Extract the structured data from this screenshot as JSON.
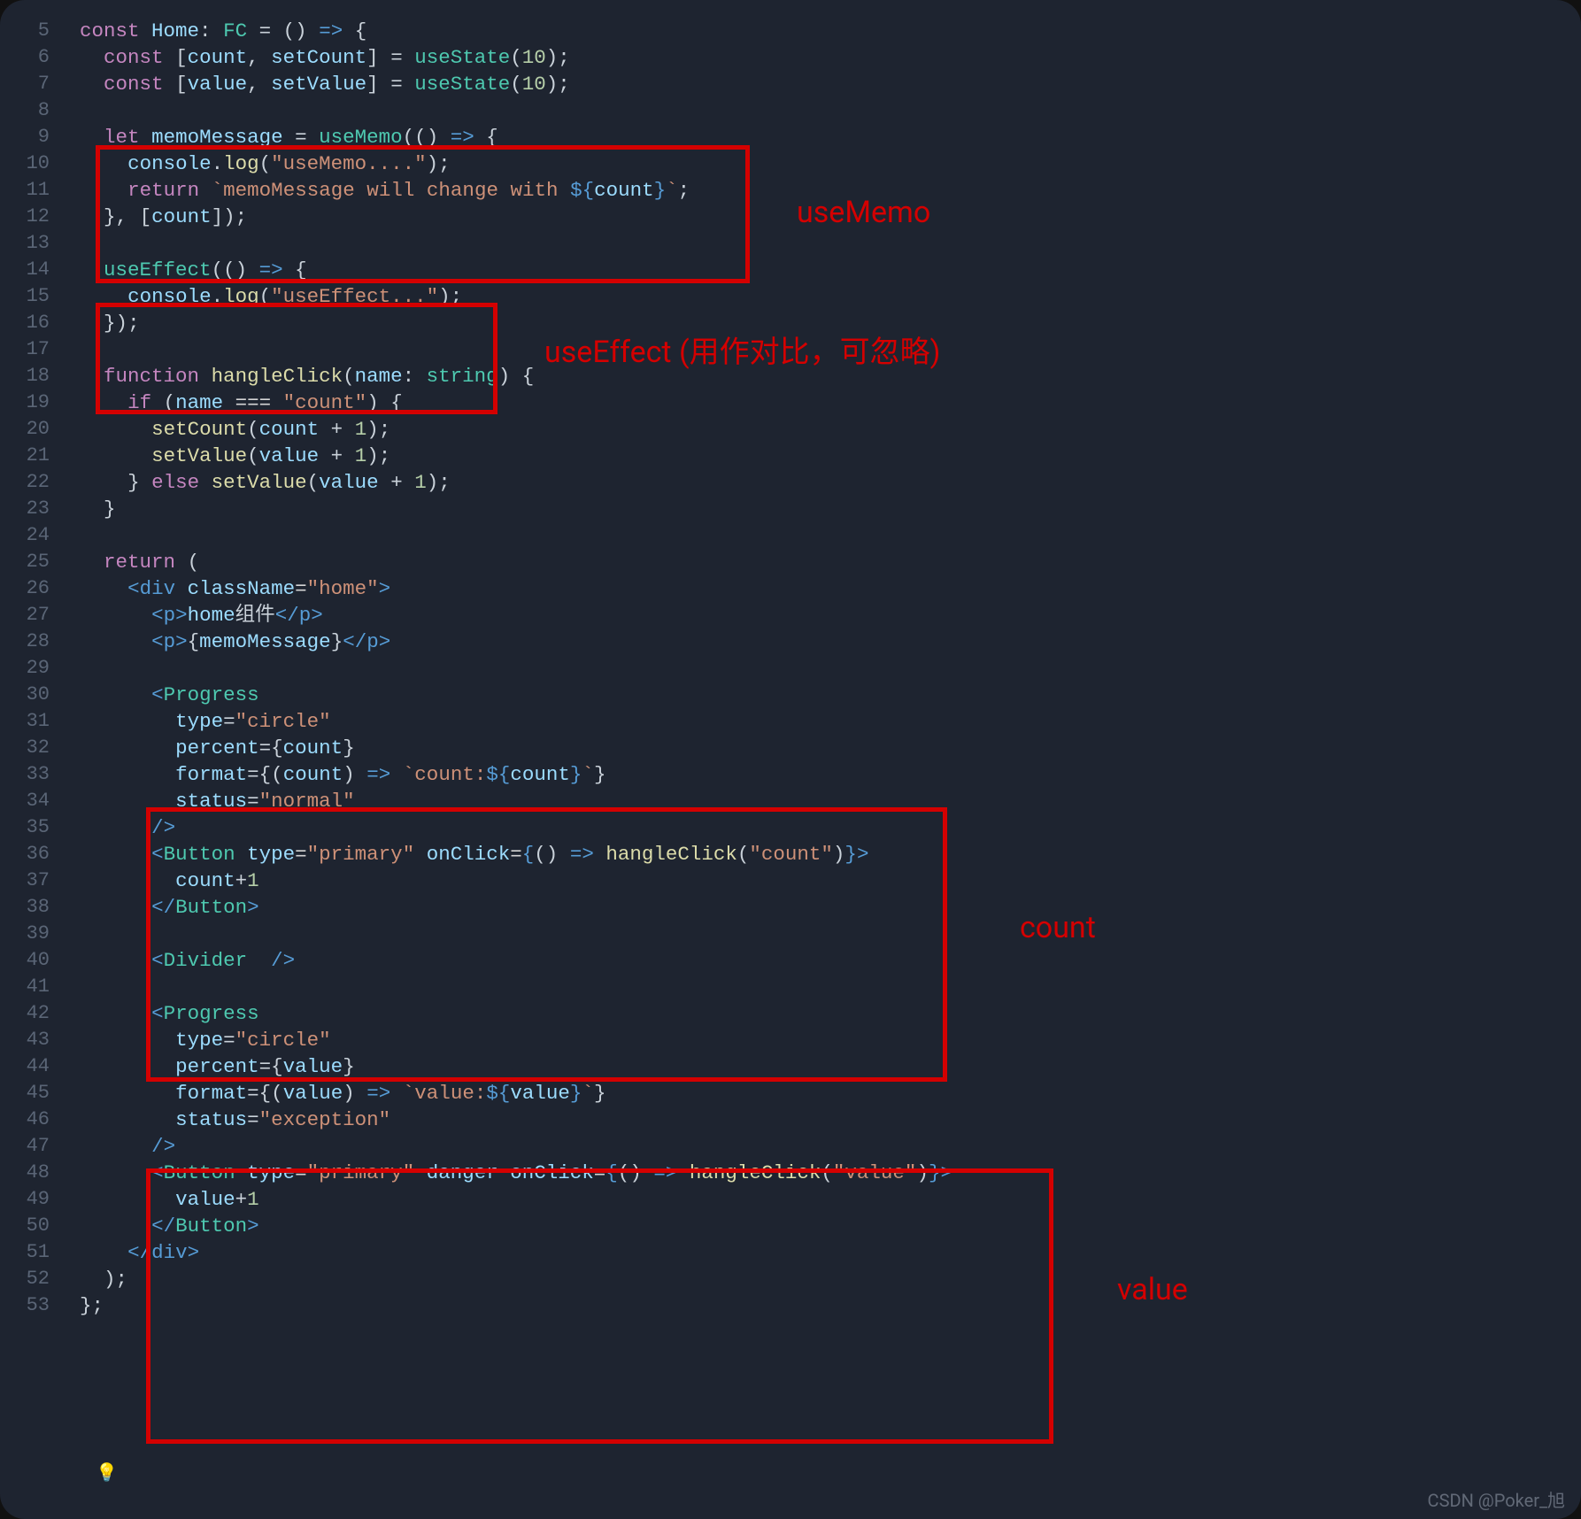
{
  "file": {
    "language": "tsx",
    "first_line_number": 5,
    "last_line_number": 53
  },
  "annotations": {
    "label_useMemo": "useMemo",
    "label_useEffect": "useEffect (用作对比，可忽略)",
    "label_count": "count",
    "label_value": "value"
  },
  "watermark": "CSDN @Poker_旭",
  "code_lines": [
    "const Home: FC = () => {",
    "  const [count, setCount] = useState(10);",
    "  const [value, setValue] = useState(10);",
    "",
    "  let memoMessage = useMemo(() => {",
    "    console.log(\"useMemo....\");",
    "    return `memoMessage will change with ${count}`;",
    "  }, [count]);",
    "",
    "  useEffect(() => {",
    "    console.log(\"useEffect...\");",
    "  });",
    "",
    "  function hangleClick(name: string) {",
    "    if (name === \"count\") {",
    "      setCount(count + 1);",
    "      setValue(value + 1);",
    "    } else setValue(value + 1);",
    "  }",
    "",
    "  return (",
    "    <div className=\"home\">",
    "      <p>home组件</p>",
    "      <p>{memoMessage}</p>",
    "",
    "      <Progress",
    "        type=\"circle\"",
    "        percent={count}",
    "        format={(count) => `count:${count}`}",
    "        status=\"normal\"",
    "      />",
    "      <Button type=\"primary\" onClick={() => hangleClick(\"count\")}>",
    "        count+1",
    "      </Button>",
    "",
    "      <Divider />",
    "",
    "      <Progress",
    "        type=\"circle\"",
    "        percent={value}",
    "        format={(value) => `value:${value}`}",
    "        status=\"exception\"",
    "      />",
    "      <Button type=\"primary\" danger onClick={() => hangleClick(\"value\")}>",
    "        value+1",
    "      </Button>",
    "    </div>",
    "  );",
    "};"
  ],
  "gutter": [
    "5",
    "6",
    "7",
    "8",
    "9",
    "10",
    "11",
    "12",
    "13",
    "14",
    "15",
    "16",
    "17",
    "18",
    "19",
    "20",
    "21",
    "22",
    "23",
    "24",
    "25",
    "26",
    "27",
    "28",
    "29",
    "30",
    "31",
    "32",
    "33",
    "34",
    "35",
    "36",
    "37",
    "38",
    "39",
    "40",
    "41",
    "42",
    "43",
    "44",
    "45",
    "46",
    "47",
    "48",
    "49",
    "50",
    "51",
    "52",
    "53"
  ]
}
